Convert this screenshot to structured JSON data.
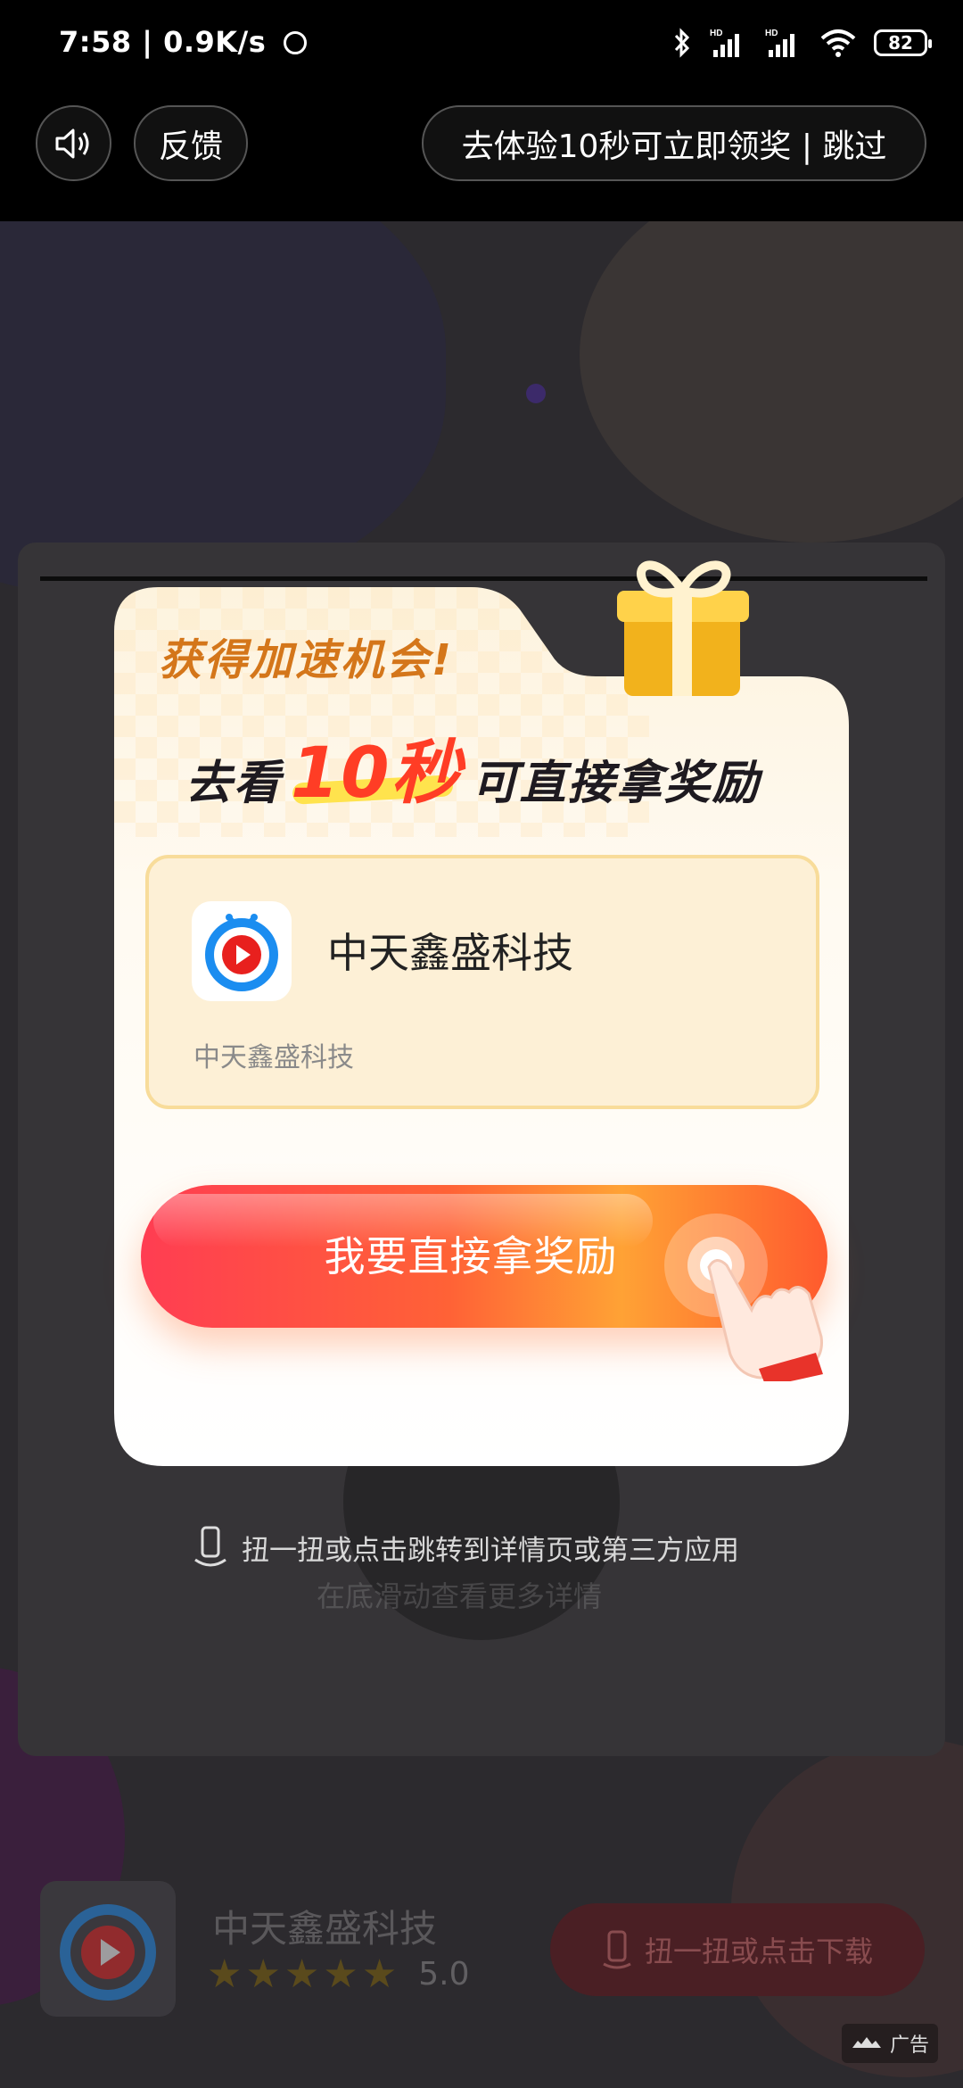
{
  "status_bar": {
    "time": "7:58 | 0.9K/s",
    "battery": "82",
    "signal_label": "HD"
  },
  "top_bar": {
    "feedback_label": "反馈",
    "skip_label": "去体验10秒可立即领奖 | 跳过"
  },
  "popup": {
    "title_small": "获得加速机会!",
    "title_prefix": "去看",
    "title_highlight": "10秒",
    "title_suffix": "可直接拿奖励",
    "app_name": "中天鑫盛科技",
    "app_desc": "中天鑫盛科技",
    "cta_label": "我要直接拿奖励"
  },
  "hint": {
    "text": "扭一扭或点击跳转到详情页或第三方应用",
    "faded_text": "在底滑动查看更多详情"
  },
  "bottom_bar": {
    "app_name": "中天鑫盛科技",
    "rating": "5.0",
    "star_count": 5,
    "download_label": "扭一扭或点击下载"
  },
  "ad_tag": {
    "label": "广告"
  },
  "colors": {
    "accent_orange": "#d4761a",
    "highlight_red": "#ff3d25",
    "cta_start": "#ff3d52",
    "cta_end": "#ffa235",
    "app_blue": "#1b8df0"
  }
}
